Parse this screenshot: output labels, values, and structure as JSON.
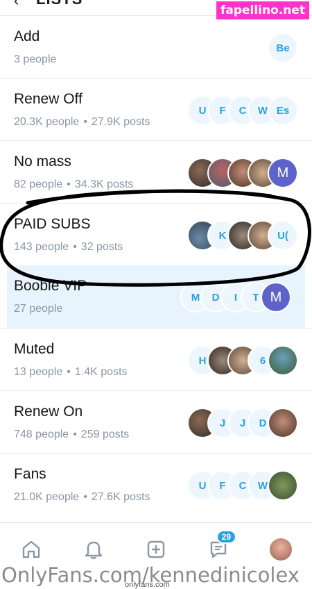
{
  "header": {
    "back_glyph": "‹",
    "title": "LISTS"
  },
  "watermark_top": "fapellino.net",
  "lists": [
    {
      "title": "Add",
      "sub": "3 people",
      "posts": "",
      "avatars": [
        "Be"
      ],
      "avatar_styles": [
        "letter"
      ]
    },
    {
      "title": "Renew Off",
      "sub": "20.3K people",
      "posts": "27.9K posts",
      "avatars": [
        "Es",
        "W",
        "C",
        "F",
        "U"
      ],
      "avatar_styles": [
        "letter",
        "letter",
        "letter",
        "letter",
        "letter"
      ]
    },
    {
      "title": "No mass",
      "sub": "82 people",
      "posts": "34.3K posts",
      "avatars": [
        "M",
        "",
        "",
        "",
        ""
      ],
      "avatar_styles": [
        "purple",
        "photo3",
        "photo7",
        "photo2",
        "photo1"
      ]
    },
    {
      "title": "PAID SUBS",
      "sub": "143 people",
      "posts": "32 posts",
      "avatars": [
        "U(",
        "",
        "",
        "K",
        ""
      ],
      "avatar_styles": [
        "letter",
        "photo3",
        "photo5",
        "letter",
        "photo4"
      ]
    },
    {
      "title": "Boobie VIP",
      "sub": "27 people",
      "posts": "",
      "avatars": [
        "M",
        "T",
        "I",
        "D",
        "M"
      ],
      "avatar_styles": [
        "purple",
        "letter",
        "letter",
        "letter",
        "letter"
      ]
    },
    {
      "title": "Muted",
      "sub": "13 people",
      "posts": "1.4K posts",
      "avatars": [
        "",
        "6",
        "",
        "",
        "H"
      ],
      "avatar_styles": [
        "photo6",
        "letter",
        "photo3",
        "photo5",
        "letter"
      ]
    },
    {
      "title": "Renew On",
      "sub": "748 people",
      "posts": "259 posts",
      "avatars": [
        "",
        "D",
        "J",
        "J",
        ""
      ],
      "avatar_styles": [
        "photo7",
        "letter",
        "letter",
        "letter",
        "photo1"
      ]
    },
    {
      "title": "Fans",
      "sub": "21.0K people",
      "posts": "27.6K posts",
      "avatars": [
        "",
        "W",
        "C",
        "F",
        "U"
      ],
      "avatar_styles": [
        "photo8",
        "letter",
        "letter",
        "letter",
        "letter"
      ]
    }
  ],
  "nav": {
    "items": [
      "home-icon",
      "bell-icon",
      "plus-square-icon",
      "messages-icon",
      "profile-avatar"
    ],
    "messages_badge": "29"
  },
  "watermark_bottom": "OnlyFans.com/kennedinicolex",
  "footnote": "onlyfans.com",
  "colors": {
    "accent": "#2aa2e0",
    "purple_avatar": "#5e63c9",
    "highlight_row": "#e8f4fd",
    "subtext": "#8a96a3"
  }
}
